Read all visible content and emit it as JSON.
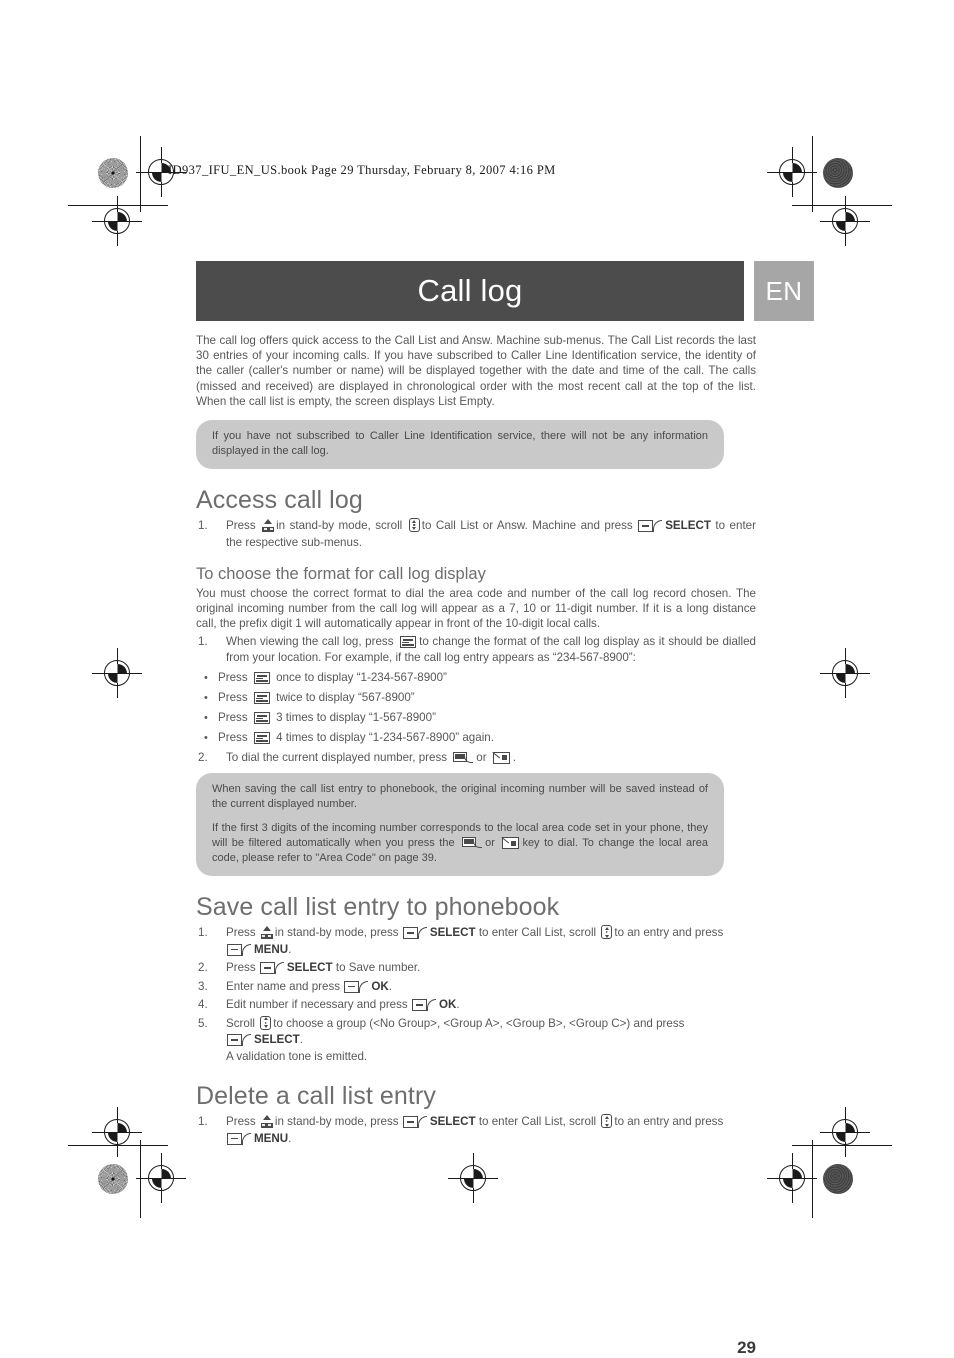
{
  "print_header": {
    "text": "ID937_IFU_EN_US.book  Page 29  Thursday, February 8, 2007  4:16 PM"
  },
  "header": {
    "title": "Call log",
    "language_tag": "EN",
    "banner_color": "#4c4c4c",
    "lang_color": "#a6a6a6"
  },
  "intro": {
    "paragraph": "The call log offers quick access to the Call List and Answ. Machine sub-menus. The Call List records the last 30 entries of your incoming calls. If you have subscribed to Caller Line Identification service, the identity of the caller (caller's number or name) will be displayed together with the date and time of the call. The calls (missed and received) are displayed in chronological order with the most recent call at the top of the list. When the call list is empty, the screen displays List Empty."
  },
  "note_1": {
    "text": "If you have not subscribed to Caller Line Identification service, there will not be any information displayed in the call log."
  },
  "section_access": {
    "heading": "Access call log",
    "step1": {
      "num": "1.",
      "t1": "Press",
      "t2": "in stand-by mode, scroll",
      "t3": "to Call List or Answ. Machine and press",
      "key_label": "SELECT",
      "t4": "to enter the respective sub-menus."
    }
  },
  "section_format": {
    "heading": "To choose the format for call log display",
    "paragraph": "You must choose the correct format to dial the area code and number of the call log record chosen. The original incoming number from the call log will appear as a 7, 10 or 11-digit number. If it is a long distance call, the prefix digit 1 will automatically appear in front of the 10-digit local calls.",
    "step1": {
      "num": "1.",
      "t1": "When viewing the call log, press",
      "t2": "to change the format of the call log display as it should be dialled from your location. For example, if the call log entry appears as “234-567-8900”:"
    },
    "bullets": [
      {
        "pre": "Press",
        "post": "once to display “1-234-567-8900”"
      },
      {
        "pre": "Press",
        "post": "twice to display “567-8900”"
      },
      {
        "pre": "Press",
        "post": "3 times to display “1-567-8900”"
      },
      {
        "pre": "Press",
        "post": "4 times to display “1-234-567-8900” again."
      }
    ],
    "step2": {
      "num": "2.",
      "t1": "To dial the current displayed number, press",
      "t2": "or",
      "t3": "."
    }
  },
  "note_2": {
    "p1": "When saving the call list entry to phonebook, the original incoming number will be saved instead of the current displayed number.",
    "p2a": "If the first 3 digits of the incoming number corresponds to the local area code set in your phone, they will be filtered automatically when you press the",
    "p2b": "or",
    "p2c": "key to dial. To change the local area code, please refer to \"Area Code\" on page 39."
  },
  "section_save": {
    "heading": "Save call list entry to phonebook",
    "steps": [
      {
        "num": "1.",
        "t1": "Press",
        "t2": "in stand-by mode, press",
        "key1": "SELECT",
        "t3": "to enter Call List, scroll",
        "t4": "to an entry and press",
        "key2": "MENU",
        "t5": "."
      },
      {
        "num": "2.",
        "t1": "Press",
        "key1": "SELECT",
        "t2": "to Save number."
      },
      {
        "num": "3.",
        "t1": "Enter name and press",
        "key1": "OK",
        "t2": "."
      },
      {
        "num": "4.",
        "t1": "Edit number if necessary and press",
        "key1": "OK",
        "t2": "."
      },
      {
        "num": "5.",
        "t1": "Scroll",
        "t2": "to choose a group (<No Group>, <Group A>, <Group B>, <Group C>) and press",
        "key1": "SELECT",
        "t3": ".",
        "t4": "A validation tone is emitted."
      }
    ]
  },
  "section_delete": {
    "heading": "Delete a call list entry",
    "step1": {
      "num": "1.",
      "t1": "Press",
      "t2": "in stand-by mode, press",
      "key1": "SELECT",
      "t3": "to enter Call List, scroll",
      "t4": "to an entry and press",
      "key2": "MENU",
      "t5": "."
    }
  },
  "footer": {
    "page_number": "29"
  }
}
